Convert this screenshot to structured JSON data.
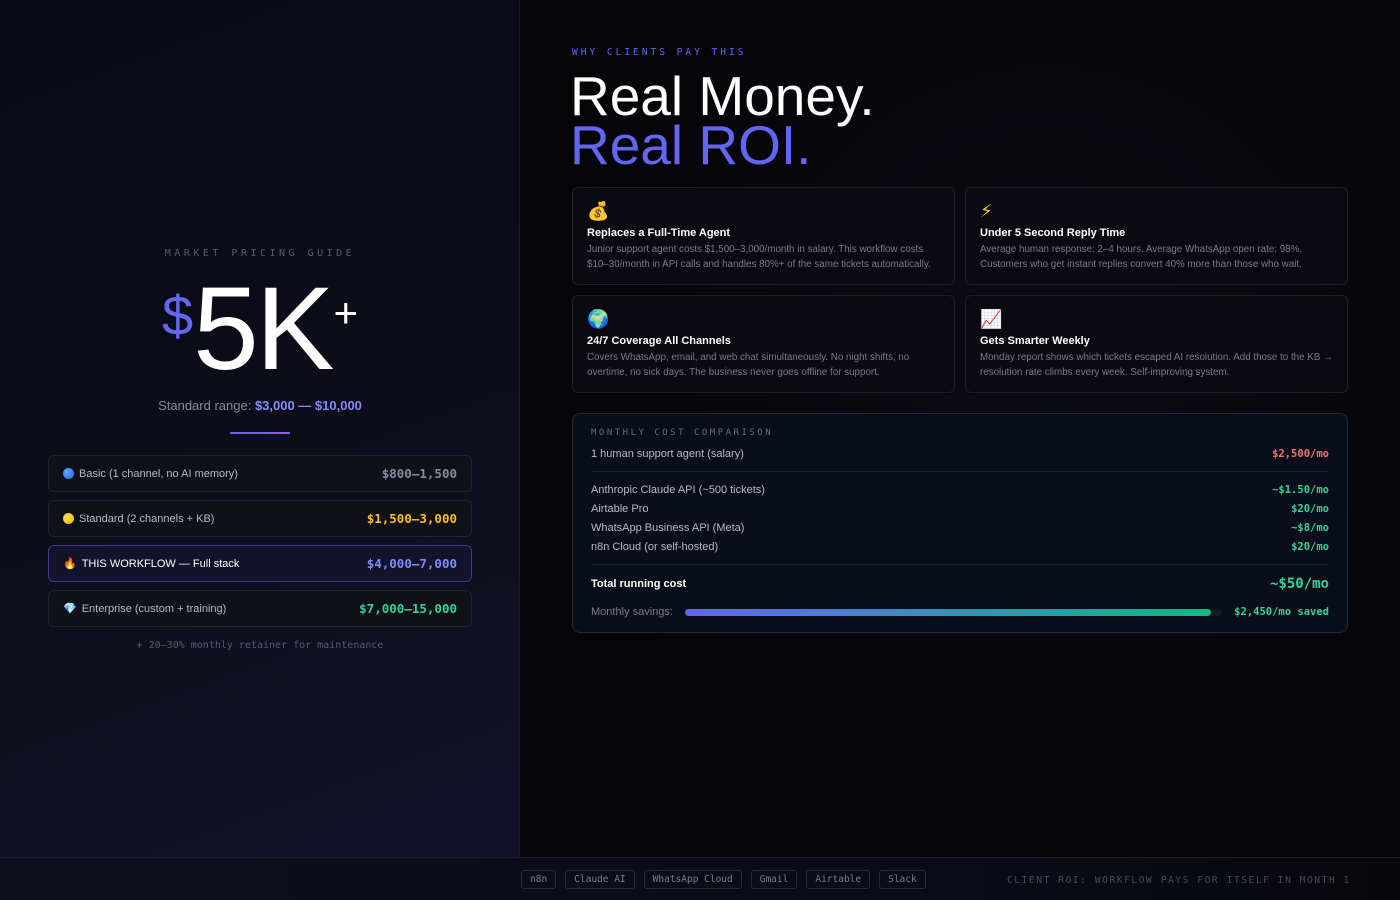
{
  "left": {
    "eyebrow": "MARKET PRICING GUIDE",
    "hero": {
      "currency": "$",
      "amount": "5K",
      "suffix": "+"
    },
    "standard_range": {
      "prefix": "Standard range:",
      "range": "$3,000 — $10,000"
    },
    "tiers": [
      {
        "icon": "blue-circle-icon",
        "label": "Basic (1 channel, no AI memory)",
        "price": "$800–1,500",
        "color": "#8a8aa0"
      },
      {
        "icon": "yellow-circle-icon",
        "label": "Standard (2 channels + KB)",
        "price": "$1,500–3,000",
        "color": "#fbbf24"
      },
      {
        "icon": "fire-icon",
        "label": "THIS WORKFLOW — Full stack",
        "price": "$4,000–7,000",
        "color": "#818cf8",
        "highlight": true
      },
      {
        "icon": "gem-icon",
        "label": "Enterprise (custom + training)",
        "price": "$7,000–15,000",
        "color": "#34d399"
      }
    ],
    "retainer_note": "+ 20–30% monthly retainer for maintenance"
  },
  "right": {
    "eyebrow": "WHY CLIENTS PAY THIS",
    "headline_line1": "Real Money.",
    "headline_line2": "Real ROI.",
    "cards": [
      {
        "icon": "money-bag-icon",
        "emoji": "💰",
        "title": "Replaces a Full-Time Agent",
        "desc": "Junior support agent costs $1,500–3,000/month in salary. This workflow costs $10–30/month in API calls and handles 80%+ of the same tickets automatically."
      },
      {
        "icon": "lightning-icon",
        "emoji": "⚡",
        "title": "Under 5 Second Reply Time",
        "desc": "Average human response: 2–4 hours. Average WhatsApp open rate: 98%. Customers who get instant replies convert 40% more than those who wait."
      },
      {
        "icon": "globe-icon",
        "emoji": "🌍",
        "title": "24/7 Coverage All Channels",
        "desc": "Covers WhatsApp, email, and web chat simultaneously. No night shifts, no overtime, no sick days. The business never goes offline for support."
      },
      {
        "icon": "chart-increasing-icon",
        "emoji": "📈",
        "title": "Gets Smarter Weekly",
        "desc": "Monday report shows which tickets escaped AI resolution. Add those to the KB → resolution rate climbs every week. Self-improving system."
      }
    ],
    "cost": {
      "title": "MONTHLY COST COMPARISON",
      "human": {
        "label": "1 human support agent (salary)",
        "value": "$2,500/mo"
      },
      "items": [
        {
          "label": "Anthropic Claude API (~500 tickets)",
          "value": "~$1.50/mo"
        },
        {
          "label": "Airtable Pro",
          "value": "$20/mo"
        },
        {
          "label": "WhatsApp Business API (Meta)",
          "value": "~$8/mo"
        },
        {
          "label": "n8n Cloud (or self-hosted)",
          "value": "$20/mo"
        }
      ],
      "total": {
        "label": "Total running cost",
        "value": "~$50/mo"
      },
      "savings": {
        "label": "Monthly savings:",
        "value": "$2,450/mo saved",
        "fraction": 0.98
      }
    }
  },
  "footer": {
    "tags": [
      "n8n",
      "Claude AI",
      "WhatsApp Cloud",
      "Gmail",
      "Airtable",
      "Slack"
    ],
    "note": "CLIENT ROI: WORKFLOW PAYS FOR ITSELF IN MONTH 1"
  },
  "colors": {
    "accent": "#6366f1",
    "green": "#34d399",
    "red": "#f87171",
    "amber": "#fbbf24"
  }
}
